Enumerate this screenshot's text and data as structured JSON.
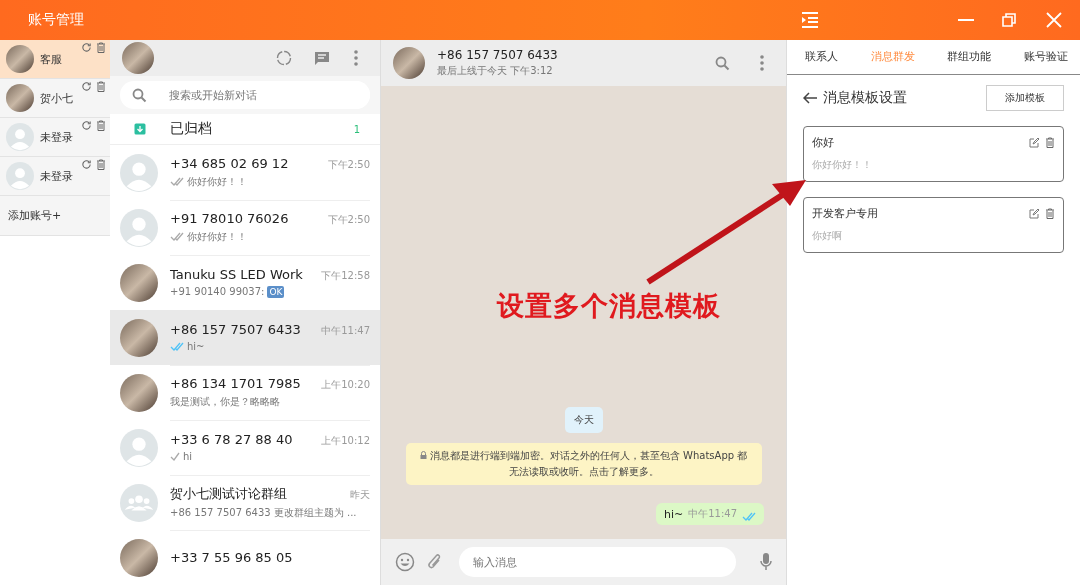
{
  "window": {
    "title": "账号管理"
  },
  "accounts": {
    "items": [
      {
        "name": "客服",
        "selected": true,
        "avatar": {
          "kind": "photo"
        }
      },
      {
        "name": "贺小七",
        "selected": false,
        "avatar": {
          "kind": "photo"
        }
      },
      {
        "name": "未登录",
        "selected": false,
        "avatar": {
          "kind": "default"
        }
      },
      {
        "name": "未登录",
        "selected": false,
        "avatar": {
          "kind": "default"
        }
      }
    ],
    "add_label": "添加账号+"
  },
  "chat_list": {
    "search_placeholder": "搜索或开始新对话",
    "archived": {
      "label": "已归档",
      "count": "1"
    },
    "chats": [
      {
        "name": "+34 685 02 69 12",
        "time": "下午2:50",
        "preview": "你好你好！！",
        "receipt": {
          "kind": "delivered"
        },
        "avatar": {
          "kind": "default"
        },
        "selected": false
      },
      {
        "name": "+91 78010 76026",
        "time": "下午2:50",
        "preview": "你好你好！！",
        "receipt": {
          "kind": "delivered"
        },
        "avatar": {
          "kind": "default"
        },
        "selected": false
      },
      {
        "name": "Tanuku SS LED Work",
        "time": "下午12:58",
        "preview": "+91 90140 99037:",
        "emoji": "OK",
        "avatar": {
          "kind": "photo"
        },
        "selected": false
      },
      {
        "name": "+86 157 7507 6433",
        "time": "中午11:47",
        "preview": "hi~",
        "receipt": {
          "kind": "read"
        },
        "avatar": {
          "kind": "photo"
        },
        "selected": true
      },
      {
        "name": "+86 134 1701 7985",
        "time": "上午10:20",
        "preview": "我是测试，你是？略略略",
        "avatar": {
          "kind": "photo"
        },
        "selected": false
      },
      {
        "name": "+33 6 78 27 88 40",
        "time": "上午10:12",
        "preview": "hi",
        "receipt": {
          "kind": "sent"
        },
        "avatar": {
          "kind": "default"
        },
        "selected": false
      },
      {
        "name": "贺小七测试讨论群组",
        "time": "昨天",
        "preview": "+86 157 7507 6433 更改群组主题为 ...",
        "avatar": {
          "kind": "group"
        },
        "selected": false
      },
      {
        "name": "+33 7 55 96 85 05",
        "avatar": {
          "kind": "photo"
        },
        "selected": false
      }
    ]
  },
  "conversation": {
    "name": "+86 157 7507 6433",
    "status": "最后上线于今天 下午3:12",
    "date": "今天",
    "notice": "消息都是进行端到端加密。对话之外的任何人，甚至包含 WhatsApp 都无法读取或收听。点击了解更多。",
    "messages": [
      {
        "text": "hi~",
        "time": "中午11:47",
        "receipt": {
          "kind": "read"
        }
      }
    ],
    "input_placeholder": "输入消息"
  },
  "side_panel": {
    "tabs": [
      {
        "label": "联系人",
        "selected": false
      },
      {
        "label": "消息群发",
        "selected": true
      },
      {
        "label": "群组功能",
        "selected": false
      },
      {
        "label": "账号验证",
        "selected": false
      }
    ],
    "page_title": "消息模板设置",
    "add_button": "添加模板",
    "templates": [
      {
        "title": "你好",
        "body": "你好你好！！"
      },
      {
        "title": "开发客户专用",
        "body": "你好啊"
      }
    ]
  },
  "annotation": {
    "text": "设置多个消息模板"
  }
}
